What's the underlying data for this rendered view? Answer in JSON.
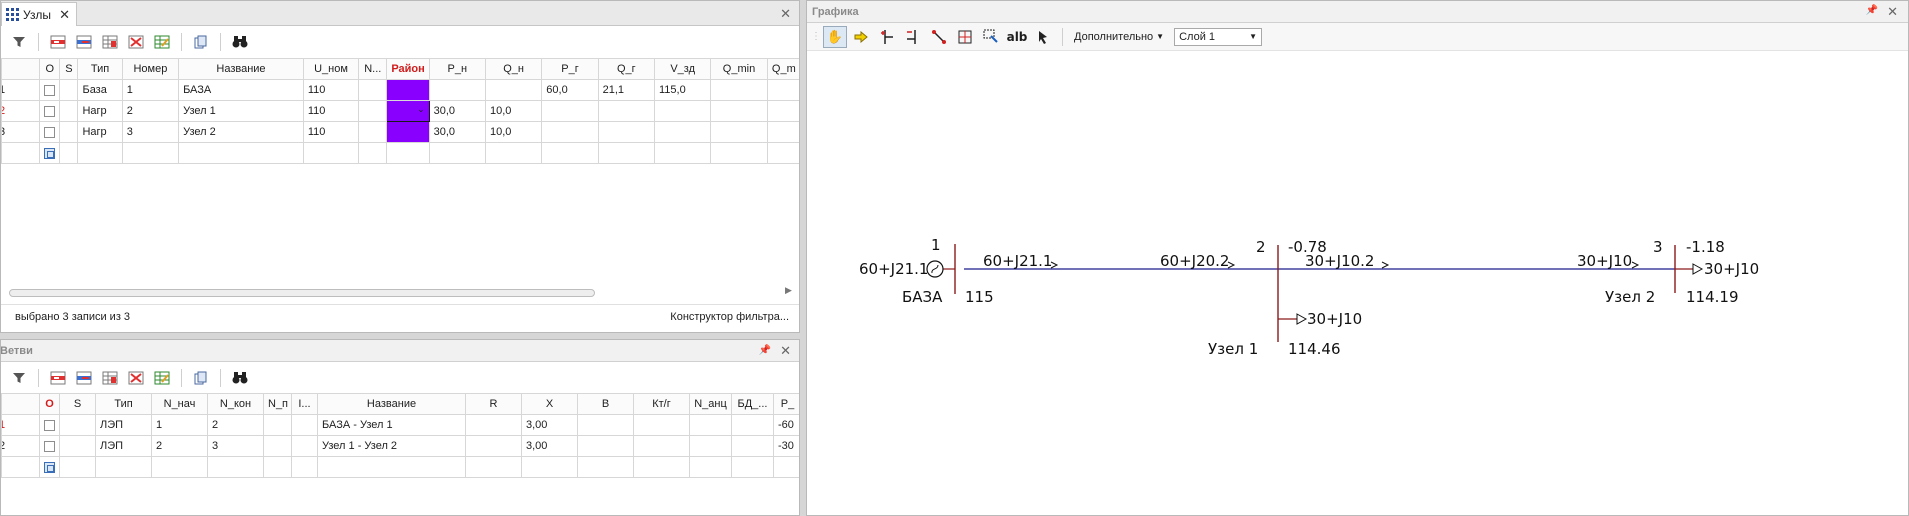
{
  "nodes_panel": {
    "tab_title": "Узлы",
    "close_glyph": "✕",
    "columns": [
      "",
      "O",
      "S",
      "Тип",
      "Номер",
      "Название",
      "U_ном",
      "N...",
      "Район",
      "P_н",
      "Q_н",
      "P_г",
      "Q_г",
      "V_зд",
      "Q_min",
      "Q_m"
    ],
    "rows": [
      {
        "rn": "1",
        "tip": "База",
        "nomer": "1",
        "name": "БАЗА",
        "u": "110",
        "p_n": "",
        "q_n": "",
        "p_g": "60,0",
        "q_g": "21,1",
        "v_zd": "115,0"
      },
      {
        "rn": "2",
        "tip": "Нагр",
        "nomer": "2",
        "name": "Узел 1",
        "u": "110",
        "p_n": "30,0",
        "q_n": "10,0",
        "p_g": "",
        "q_g": "",
        "v_zd": ""
      },
      {
        "rn": "3",
        "tip": "Нагр",
        "nomer": "3",
        "name": "Узел 2",
        "u": "110",
        "p_n": "30,0",
        "q_n": "10,0",
        "p_g": "",
        "q_g": "",
        "v_zd": ""
      }
    ],
    "status_left": "выбрано 3 записи из 3",
    "status_right": "Конструктор фильтра..."
  },
  "branches_panel": {
    "title": "Ветви",
    "columns": [
      "",
      "O",
      "S",
      "Тип",
      "N_нач",
      "N_кон",
      "N_п",
      "I...",
      "Название",
      "R",
      "X",
      "B",
      "Кт/г",
      "N_анц",
      "БД_...",
      "P_"
    ],
    "rows": [
      {
        "rn": "1",
        "tip": "ЛЭП",
        "n_nach": "1",
        "n_kon": "2",
        "name": "БАЗА - Узел 1",
        "x": "3,00",
        "p": "-60"
      },
      {
        "rn": "2",
        "tip": "ЛЭП",
        "n_nach": "2",
        "n_kon": "3",
        "name": "Узел 1 - Узел 2",
        "x": "3,00",
        "p": "-30"
      }
    ]
  },
  "graphics_panel": {
    "title": "Графика",
    "more_label": "Дополнительно",
    "layer_value": "Слой 1",
    "diagram": {
      "node1": {
        "num": "1",
        "gen": "60+J21.1",
        "name": "БАЗА",
        "voltage": "115"
      },
      "node2": {
        "num": "2",
        "angle": "-0.78",
        "name": "Узел 1",
        "voltage": "114.46",
        "load": "30+J10"
      },
      "node3": {
        "num": "3",
        "angle": "-1.18",
        "name": "Узел 2",
        "voltage": "114.19",
        "load": "30+J10"
      },
      "flow_1_2_start": "60+J21.1",
      "flow_1_2_end": "60+J20.2",
      "flow_2_3_start": "30+J10.2",
      "flow_2_3_end": "30+J10"
    }
  },
  "colors": {
    "district": "#8a00ff",
    "line": "#1c1c8c",
    "bus": "#8b1a1a"
  }
}
